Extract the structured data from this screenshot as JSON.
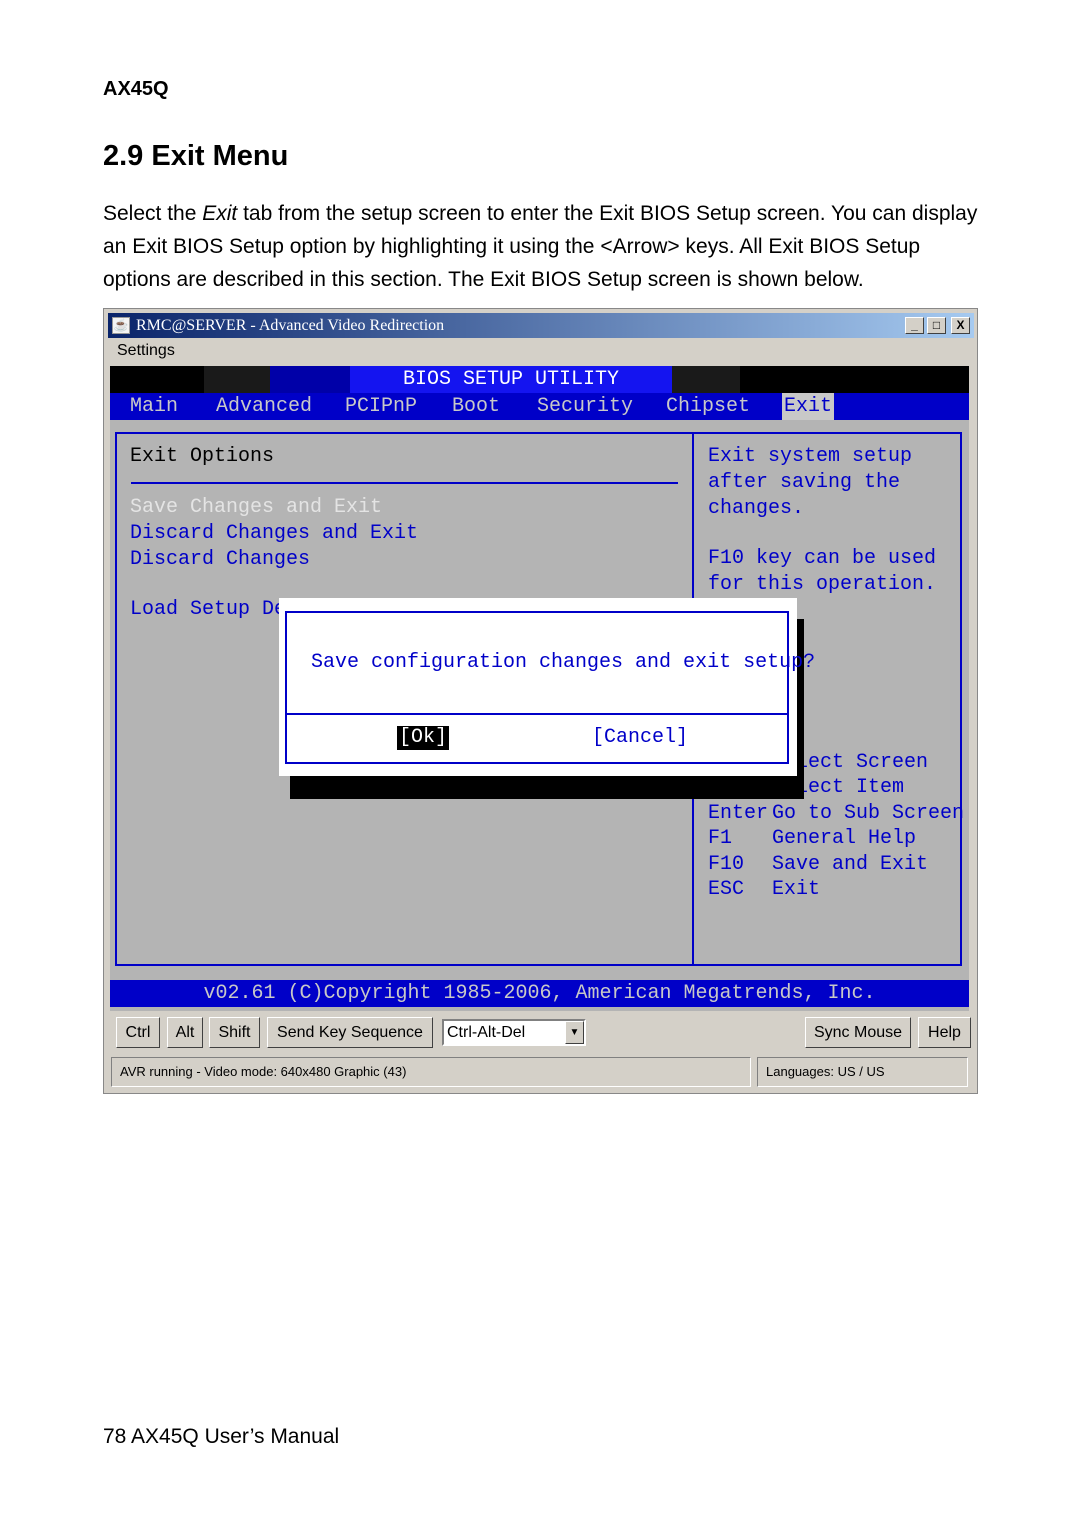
{
  "doc": {
    "header": "AX45Q",
    "section_title": "2.9 Exit Menu",
    "intro_pre": "Select the ",
    "intro_em": "Exit",
    "intro_post": " tab from the setup screen to enter the Exit BIOS Setup screen. You can display an Exit BIOS Setup option by highlighting it using the <Arrow> keys. All Exit BIOS Setup options are described in this section. The Exit BIOS Setup screen is shown below.",
    "footer": "78 AX45Q User’s Manual"
  },
  "window": {
    "title": "RMC@SERVER - Advanced Video Redirection",
    "menu": "Settings",
    "minimize": "_",
    "maximize": "□",
    "close": "X"
  },
  "bios": {
    "title": "BIOS SETUP UTILITY",
    "tabs": [
      "Main",
      "Advanced",
      "PCIPnP",
      "Boot",
      "Security",
      "Chipset",
      "Exit"
    ],
    "active_tab": "Exit",
    "section": "Exit Options",
    "options": [
      "Save Changes and Exit",
      "Discard Changes and Exit",
      "Discard Changes",
      "Load Setup Defaults"
    ],
    "selected_option": "Save Changes and Exit",
    "help": [
      "Exit system setup",
      "after saving the",
      "changes.",
      "",
      "F10 key can be used",
      "for this operation."
    ],
    "keys": [
      [
        "←→",
        "Select Screen"
      ],
      [
        "↑↓",
        "Select Item"
      ],
      [
        "Enter",
        "Go to Sub Screen"
      ],
      [
        "F1",
        "General Help"
      ],
      [
        "F10",
        "Save and Exit"
      ],
      [
        "ESC",
        "Exit"
      ]
    ],
    "dialog": {
      "message": "Save configuration changes and exit setup?",
      "ok": "[Ok]",
      "cancel": "[Cancel]"
    },
    "copyright": "v02.61 (C)Copyright 1985-2006, American Megatrends, Inc."
  },
  "toolbar": {
    "ctrl": "Ctrl",
    "alt": "Alt",
    "shift": "Shift",
    "send": "Send Key Sequence",
    "sequence": "Ctrl-Alt-Del",
    "sync": "Sync Mouse",
    "help": "Help"
  },
  "status": {
    "left": "AVR running - Video mode: 640x480 Graphic (43)",
    "right": "Languages: US / US"
  }
}
